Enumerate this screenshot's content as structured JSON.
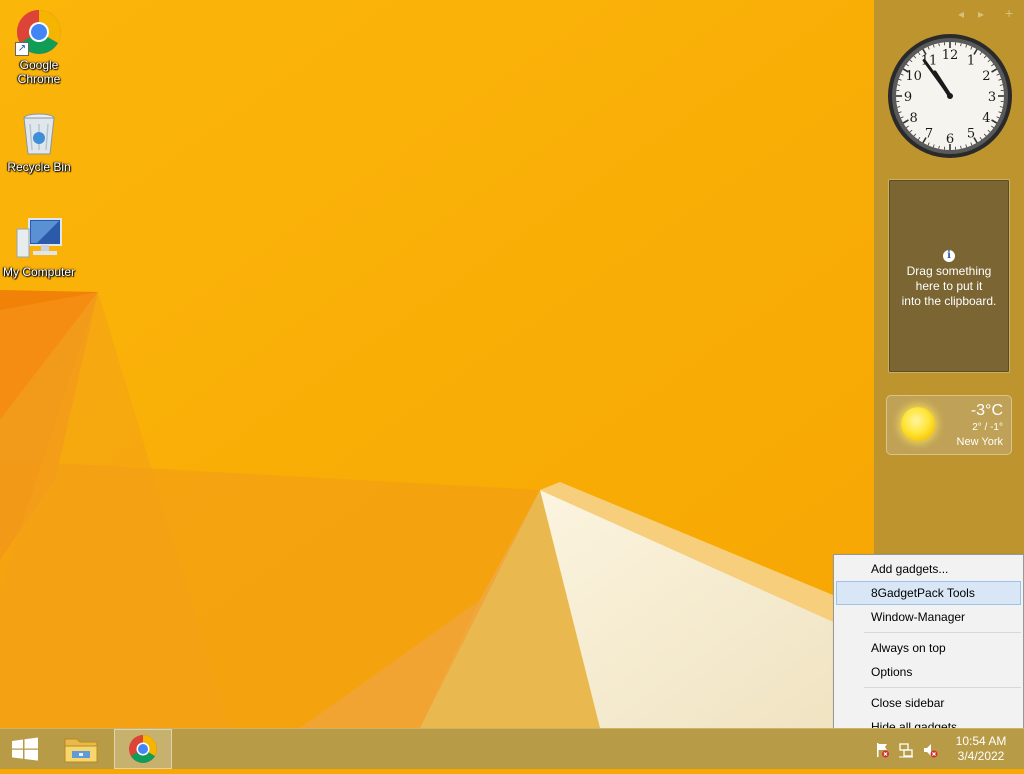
{
  "colors": {
    "wallpaper_main": "#f7a805",
    "sidebar": "#b89232",
    "taskbar": "#b79b47",
    "menu_highlight": "#d8e6f5"
  },
  "desktop": {
    "icons": [
      {
        "label": "Google Chrome",
        "icon": "chrome-icon"
      },
      {
        "label": "Recycle Bin",
        "icon": "recycle-bin-icon"
      },
      {
        "label": "My Computer",
        "icon": "computer-icon"
      }
    ]
  },
  "sidebar": {
    "nav_prev": "◂",
    "nav_next": "▸",
    "add": "+",
    "clock": {
      "numerals": [
        "12",
        "1",
        "2",
        "3",
        "4",
        "5",
        "6",
        "7",
        "8",
        "9",
        "10",
        "11"
      ],
      "time": "10:54"
    },
    "clipboard": {
      "info_icon": "i",
      "lines": [
        "Drag something",
        "here to put it",
        "into the clipboard."
      ]
    },
    "weather": {
      "icon": "sun-icon",
      "temperature": "-3°C",
      "range": "2° / -1°",
      "city": "New York"
    }
  },
  "context_menu": {
    "groups": [
      [
        {
          "label": "Add gadgets...",
          "highlighted": false
        },
        {
          "label": "8GadgetPack Tools",
          "highlighted": true
        },
        {
          "label": "Window-Manager",
          "highlighted": false
        }
      ],
      [
        {
          "label": "Always on top",
          "highlighted": false
        },
        {
          "label": "Options",
          "highlighted": false
        }
      ],
      [
        {
          "label": "Close sidebar",
          "highlighted": false
        },
        {
          "label": "Hide all gadgets",
          "highlighted": false
        }
      ]
    ]
  },
  "taskbar": {
    "buttons": [
      {
        "name": "start",
        "icon": "windows-logo-icon"
      },
      {
        "name": "file-explorer",
        "icon": "folder-icon"
      },
      {
        "name": "google-chrome",
        "icon": "chrome-icon",
        "active": true
      }
    ],
    "tray": {
      "icons": [
        "action-center-flag-icon",
        "network-icon",
        "volume-muted-icon"
      ],
      "time": "10:54 AM",
      "date": "3/4/2022"
    }
  }
}
